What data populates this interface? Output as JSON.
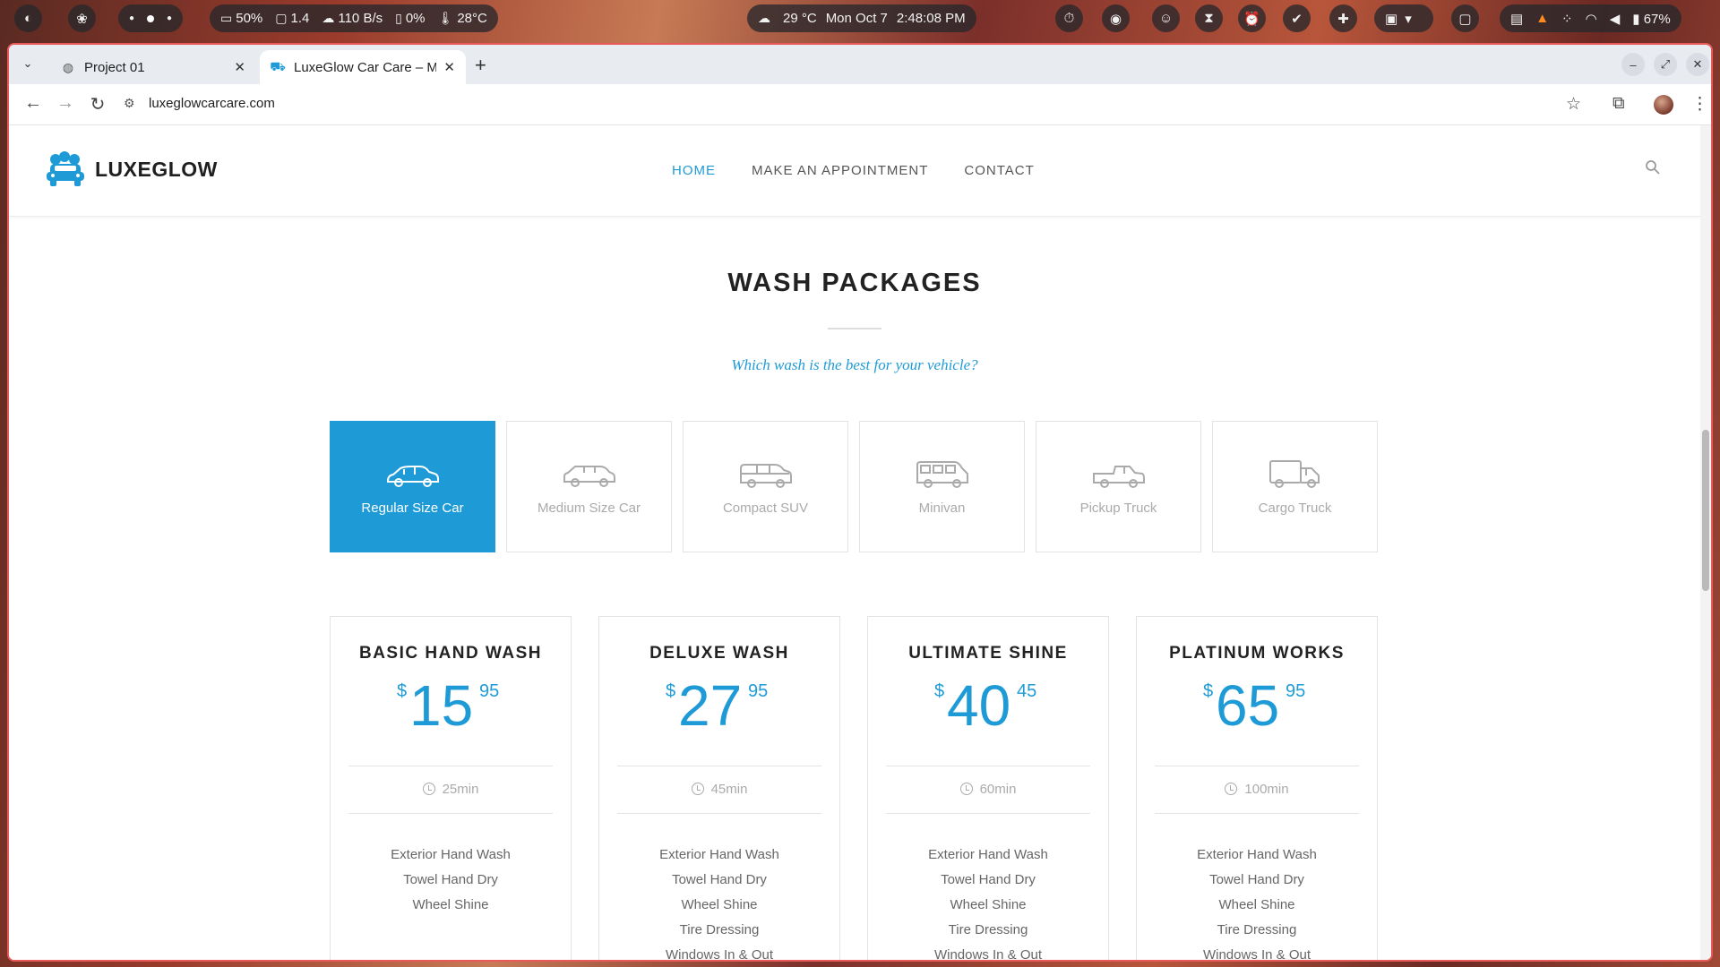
{
  "os": {
    "cpu": "50%",
    "load": "1.4",
    "net": "110 B/s",
    "disk": "0%",
    "temp": "28°C",
    "weather": "29 °C",
    "date": "Mon Oct 7",
    "time": "2:48:08 PM",
    "battery": "67%"
  },
  "browser": {
    "tabs": [
      {
        "title": "Project 01"
      },
      {
        "title": "LuxeGlow Car Care – Mo"
      }
    ],
    "url": "luxeglowcarcare.com"
  },
  "site": {
    "brand": "LUXEGLOW",
    "nav": [
      "HOME",
      "MAKE AN APPOINTMENT",
      "CONTACT"
    ],
    "section_title": "WASH PACKAGES",
    "subtitle": "Which wash is the best for your vehicle?",
    "accent": "#1e9bd7",
    "vehicle_types": [
      {
        "label": "Regular Size Car",
        "icon": "sedan-icon",
        "active": true
      },
      {
        "label": "Medium Size Car",
        "icon": "wagon-icon",
        "active": false
      },
      {
        "label": "Compact SUV",
        "icon": "suv-icon",
        "active": false
      },
      {
        "label": "Minivan",
        "icon": "minivan-icon",
        "active": false
      },
      {
        "label": "Pickup Truck",
        "icon": "pickup-icon",
        "active": false
      },
      {
        "label": "Cargo Truck",
        "icon": "cargo-truck-icon",
        "active": false
      }
    ],
    "packages": [
      {
        "name": "BASIC HAND WASH",
        "currency": "$",
        "dollars": "15",
        "cents": "95",
        "duration": "25min",
        "features": [
          "Exterior Hand Wash",
          "Towel Hand Dry",
          "Wheel Shine"
        ]
      },
      {
        "name": "DELUXE WASH",
        "currency": "$",
        "dollars": "27",
        "cents": "95",
        "duration": "45min",
        "features": [
          "Exterior Hand Wash",
          "Towel Hand Dry",
          "Wheel Shine",
          "Tire Dressing",
          "Windows In & Out"
        ]
      },
      {
        "name": "ULTIMATE SHINE",
        "currency": "$",
        "dollars": "40",
        "cents": "45",
        "duration": "60min",
        "features": [
          "Exterior Hand Wash",
          "Towel Hand Dry",
          "Wheel Shine",
          "Tire Dressing",
          "Windows In & Out"
        ]
      },
      {
        "name": "PLATINUM WORKS",
        "currency": "$",
        "dollars": "65",
        "cents": "95",
        "duration": "100min",
        "features": [
          "Exterior Hand Wash",
          "Towel Hand Dry",
          "Wheel Shine",
          "Tire Dressing",
          "Windows In & Out"
        ]
      }
    ]
  }
}
